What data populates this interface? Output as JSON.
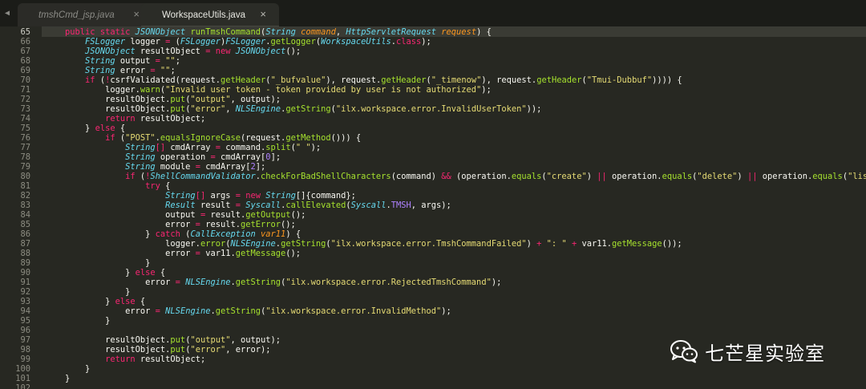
{
  "tabs": [
    {
      "label": "tmshCmd_jsp.java",
      "close": "×",
      "active": false
    },
    {
      "label": "WorkspaceUtils.java",
      "close": "×",
      "active": true
    }
  ],
  "tab_scroll_icon": "◀",
  "watermark": {
    "text": "七芒星实验室",
    "icon": "wechat-icon"
  },
  "colors": {
    "background": "#272822",
    "keyword": "#f92672",
    "type": "#66d9ef",
    "function": "#a6e22e",
    "string": "#e6db74",
    "number": "#ae81ff",
    "param": "#fd971f",
    "plain": "#f8f8f2"
  },
  "editor": {
    "current_line": "65",
    "lines": [
      {
        "n": "65",
        "tokens": [
          [
            "pl",
            "    "
          ],
          [
            "kw",
            "public static "
          ],
          [
            "ty",
            "JSONObject "
          ],
          [
            "fn",
            "runTmshCommand"
          ],
          [
            "pl",
            "("
          ],
          [
            "ty",
            "String "
          ],
          [
            "pa",
            "command"
          ],
          [
            "pl",
            ", "
          ],
          [
            "ty",
            "HttpServletRequest "
          ],
          [
            "pa",
            "request"
          ],
          [
            "pl",
            ") {"
          ]
        ]
      },
      {
        "n": "66",
        "tokens": [
          [
            "pl",
            "        "
          ],
          [
            "ty",
            "FSLogger"
          ],
          [
            "pl",
            " logger "
          ],
          [
            "kw",
            "="
          ],
          [
            "pl",
            " ("
          ],
          [
            "ty",
            "FSLogger"
          ],
          [
            "pl",
            ")"
          ],
          [
            "ty",
            "FSLogger"
          ],
          [
            "pl",
            "."
          ],
          [
            "fn",
            "getLogger"
          ],
          [
            "pl",
            "("
          ],
          [
            "ty",
            "WorkspaceUtils"
          ],
          [
            "pl",
            "."
          ],
          [
            "kw",
            "class"
          ],
          [
            "pl",
            ");"
          ]
        ]
      },
      {
        "n": "67",
        "tokens": [
          [
            "pl",
            "        "
          ],
          [
            "ty",
            "JSONObject"
          ],
          [
            "pl",
            " resultObject "
          ],
          [
            "kw",
            "= new "
          ],
          [
            "ty",
            "JSONObject"
          ],
          [
            "pl",
            "();"
          ]
        ]
      },
      {
        "n": "68",
        "tokens": [
          [
            "pl",
            "        "
          ],
          [
            "ty",
            "String"
          ],
          [
            "pl",
            " output "
          ],
          [
            "kw",
            "="
          ],
          [
            "pl",
            " "
          ],
          [
            "st",
            "\"\""
          ],
          [
            "pl",
            ";"
          ]
        ]
      },
      {
        "n": "69",
        "tokens": [
          [
            "pl",
            "        "
          ],
          [
            "ty",
            "String"
          ],
          [
            "pl",
            " error "
          ],
          [
            "kw",
            "="
          ],
          [
            "pl",
            " "
          ],
          [
            "st",
            "\"\""
          ],
          [
            "pl",
            ";"
          ]
        ]
      },
      {
        "n": "70",
        "tokens": [
          [
            "pl",
            "        "
          ],
          [
            "kw",
            "if"
          ],
          [
            "pl",
            " ("
          ],
          [
            "kw",
            "!"
          ],
          [
            "pl",
            "csrfValidated(request."
          ],
          [
            "fn",
            "getHeader"
          ],
          [
            "pl",
            "("
          ],
          [
            "st",
            "\"_bufvalue\""
          ],
          [
            "pl",
            "), request."
          ],
          [
            "fn",
            "getHeader"
          ],
          [
            "pl",
            "("
          ],
          [
            "st",
            "\"_timenow\""
          ],
          [
            "pl",
            "), request."
          ],
          [
            "fn",
            "getHeader"
          ],
          [
            "pl",
            "("
          ],
          [
            "st",
            "\"Tmui-Dubbuf\""
          ],
          [
            "pl",
            ")))) {"
          ]
        ]
      },
      {
        "n": "71",
        "tokens": [
          [
            "pl",
            "            logger."
          ],
          [
            "fn",
            "warn"
          ],
          [
            "pl",
            "("
          ],
          [
            "st",
            "\"Invalid user token - token provided by user is not authorized\""
          ],
          [
            "pl",
            ");"
          ]
        ]
      },
      {
        "n": "72",
        "tokens": [
          [
            "pl",
            "            resultObject."
          ],
          [
            "fn",
            "put"
          ],
          [
            "pl",
            "("
          ],
          [
            "st",
            "\"output\""
          ],
          [
            "pl",
            ", output);"
          ]
        ]
      },
      {
        "n": "73",
        "tokens": [
          [
            "pl",
            "            resultObject."
          ],
          [
            "fn",
            "put"
          ],
          [
            "pl",
            "("
          ],
          [
            "st",
            "\"error\""
          ],
          [
            "pl",
            ", "
          ],
          [
            "ty",
            "NLSEngine"
          ],
          [
            "pl",
            "."
          ],
          [
            "fn",
            "getString"
          ],
          [
            "pl",
            "("
          ],
          [
            "st",
            "\"ilx.workspace.error.InvalidUserToken\""
          ],
          [
            "pl",
            "));"
          ]
        ]
      },
      {
        "n": "74",
        "tokens": [
          [
            "pl",
            "            "
          ],
          [
            "kw",
            "return"
          ],
          [
            "pl",
            " resultObject;"
          ]
        ]
      },
      {
        "n": "75",
        "tokens": [
          [
            "pl",
            "        } "
          ],
          [
            "kw",
            "else"
          ],
          [
            "pl",
            " {"
          ]
        ]
      },
      {
        "n": "76",
        "tokens": [
          [
            "pl",
            "            "
          ],
          [
            "kw",
            "if"
          ],
          [
            "pl",
            " ("
          ],
          [
            "st",
            "\"POST\""
          ],
          [
            "pl",
            "."
          ],
          [
            "fn",
            "equalsIgnoreCase"
          ],
          [
            "pl",
            "(request."
          ],
          [
            "fn",
            "getMethod"
          ],
          [
            "pl",
            "())) {"
          ]
        ]
      },
      {
        "n": "77",
        "tokens": [
          [
            "pl",
            "                "
          ],
          [
            "ty",
            "String"
          ],
          [
            "kw",
            "[]"
          ],
          [
            "pl",
            " cmdArray "
          ],
          [
            "kw",
            "="
          ],
          [
            "pl",
            " command."
          ],
          [
            "fn",
            "split"
          ],
          [
            "pl",
            "("
          ],
          [
            "st",
            "\" \""
          ],
          [
            "pl",
            ");"
          ]
        ]
      },
      {
        "n": "78",
        "tokens": [
          [
            "pl",
            "                "
          ],
          [
            "ty",
            "String"
          ],
          [
            "pl",
            " operation "
          ],
          [
            "kw",
            "="
          ],
          [
            "pl",
            " cmdArray["
          ],
          [
            "nu",
            "0"
          ],
          [
            "pl",
            "];"
          ]
        ]
      },
      {
        "n": "79",
        "tokens": [
          [
            "pl",
            "                "
          ],
          [
            "ty",
            "String"
          ],
          [
            "pl",
            " module "
          ],
          [
            "kw",
            "="
          ],
          [
            "pl",
            " cmdArray["
          ],
          [
            "nu",
            "2"
          ],
          [
            "pl",
            "];"
          ]
        ]
      },
      {
        "n": "80",
        "tokens": [
          [
            "pl",
            "                "
          ],
          [
            "kw",
            "if"
          ],
          [
            "pl",
            " ("
          ],
          [
            "kw",
            "!"
          ],
          [
            "ty",
            "ShellCommandValidator"
          ],
          [
            "pl",
            "."
          ],
          [
            "fn",
            "checkForBadShellCharacters"
          ],
          [
            "pl",
            "(command) "
          ],
          [
            "kw",
            "&&"
          ],
          [
            "pl",
            " (operation."
          ],
          [
            "fn",
            "equals"
          ],
          [
            "pl",
            "("
          ],
          [
            "st",
            "\"create\""
          ],
          [
            "pl",
            ") "
          ],
          [
            "kw",
            "||"
          ],
          [
            "pl",
            " operation."
          ],
          [
            "fn",
            "equals"
          ],
          [
            "pl",
            "("
          ],
          [
            "st",
            "\"delete\""
          ],
          [
            "pl",
            ") "
          ],
          [
            "kw",
            "||"
          ],
          [
            "pl",
            " operation."
          ],
          [
            "fn",
            "equals"
          ],
          [
            "pl",
            "("
          ],
          [
            "st",
            "\"list\""
          ],
          [
            "pl",
            ") "
          ],
          [
            "kw",
            "||"
          ],
          [
            "pl",
            " operation."
          ],
          [
            "fn",
            "equals"
          ],
          [
            "pl",
            "("
          ]
        ]
      },
      {
        "n": "81",
        "tokens": [
          [
            "pl",
            "                    "
          ],
          [
            "kw",
            "try"
          ],
          [
            "pl",
            " {"
          ]
        ]
      },
      {
        "n": "82",
        "tokens": [
          [
            "pl",
            "                        "
          ],
          [
            "ty",
            "String"
          ],
          [
            "kw",
            "[]"
          ],
          [
            "pl",
            " args "
          ],
          [
            "kw",
            "= new "
          ],
          [
            "ty",
            "String"
          ],
          [
            "pl",
            "[]{command};"
          ]
        ]
      },
      {
        "n": "83",
        "tokens": [
          [
            "pl",
            "                        "
          ],
          [
            "ty",
            "Result"
          ],
          [
            "pl",
            " result "
          ],
          [
            "kw",
            "="
          ],
          [
            "pl",
            " "
          ],
          [
            "ty",
            "Syscall"
          ],
          [
            "pl",
            "."
          ],
          [
            "fn",
            "callElevated"
          ],
          [
            "pl",
            "("
          ],
          [
            "ty",
            "Syscall"
          ],
          [
            "pl",
            "."
          ],
          [
            "nu",
            "TMSH"
          ],
          [
            "pl",
            ", args);"
          ]
        ]
      },
      {
        "n": "84",
        "tokens": [
          [
            "pl",
            "                        output "
          ],
          [
            "kw",
            "="
          ],
          [
            "pl",
            " result."
          ],
          [
            "fn",
            "getOutput"
          ],
          [
            "pl",
            "();"
          ]
        ]
      },
      {
        "n": "85",
        "tokens": [
          [
            "pl",
            "                        error "
          ],
          [
            "kw",
            "="
          ],
          [
            "pl",
            " result."
          ],
          [
            "fn",
            "getError"
          ],
          [
            "pl",
            "();"
          ]
        ]
      },
      {
        "n": "86",
        "tokens": [
          [
            "pl",
            "                    } "
          ],
          [
            "kw",
            "catch"
          ],
          [
            "pl",
            " ("
          ],
          [
            "ty",
            "CallException"
          ],
          [
            "pl",
            " "
          ],
          [
            "pa",
            "var11"
          ],
          [
            "pl",
            ") {"
          ]
        ]
      },
      {
        "n": "87",
        "tokens": [
          [
            "pl",
            "                        logger."
          ],
          [
            "fn",
            "error"
          ],
          [
            "pl",
            "("
          ],
          [
            "ty",
            "NLSEngine"
          ],
          [
            "pl",
            "."
          ],
          [
            "fn",
            "getString"
          ],
          [
            "pl",
            "("
          ],
          [
            "st",
            "\"ilx.workspace.error.TmshCommandFailed\""
          ],
          [
            "pl",
            ") "
          ],
          [
            "kw",
            "+"
          ],
          [
            "pl",
            " "
          ],
          [
            "st",
            "\": \""
          ],
          [
            "pl",
            " "
          ],
          [
            "kw",
            "+"
          ],
          [
            "pl",
            " var11."
          ],
          [
            "fn",
            "getMessage"
          ],
          [
            "pl",
            "());"
          ]
        ]
      },
      {
        "n": "88",
        "tokens": [
          [
            "pl",
            "                        error "
          ],
          [
            "kw",
            "="
          ],
          [
            "pl",
            " var11."
          ],
          [
            "fn",
            "getMessage"
          ],
          [
            "pl",
            "();"
          ]
        ]
      },
      {
        "n": "89",
        "tokens": [
          [
            "pl",
            "                    }"
          ]
        ]
      },
      {
        "n": "90",
        "tokens": [
          [
            "pl",
            "                } "
          ],
          [
            "kw",
            "else"
          ],
          [
            "pl",
            " {"
          ]
        ]
      },
      {
        "n": "91",
        "tokens": [
          [
            "pl",
            "                    error "
          ],
          [
            "kw",
            "="
          ],
          [
            "pl",
            " "
          ],
          [
            "ty",
            "NLSEngine"
          ],
          [
            "pl",
            "."
          ],
          [
            "fn",
            "getString"
          ],
          [
            "pl",
            "("
          ],
          [
            "st",
            "\"ilx.workspace.error.RejectedTmshCommand\""
          ],
          [
            "pl",
            ");"
          ]
        ]
      },
      {
        "n": "92",
        "tokens": [
          [
            "pl",
            "                }"
          ]
        ]
      },
      {
        "n": "93",
        "tokens": [
          [
            "pl",
            "            } "
          ],
          [
            "kw",
            "else"
          ],
          [
            "pl",
            " {"
          ]
        ]
      },
      {
        "n": "94",
        "tokens": [
          [
            "pl",
            "                error "
          ],
          [
            "kw",
            "="
          ],
          [
            "pl",
            " "
          ],
          [
            "ty",
            "NLSEngine"
          ],
          [
            "pl",
            "."
          ],
          [
            "fn",
            "getString"
          ],
          [
            "pl",
            "("
          ],
          [
            "st",
            "\"ilx.workspace.error.InvalidMethod\""
          ],
          [
            "pl",
            ");"
          ]
        ]
      },
      {
        "n": "95",
        "tokens": [
          [
            "pl",
            "            }"
          ]
        ]
      },
      {
        "n": "96",
        "tokens": []
      },
      {
        "n": "97",
        "tokens": [
          [
            "pl",
            "            resultObject."
          ],
          [
            "fn",
            "put"
          ],
          [
            "pl",
            "("
          ],
          [
            "st",
            "\"output\""
          ],
          [
            "pl",
            ", output);"
          ]
        ]
      },
      {
        "n": "98",
        "tokens": [
          [
            "pl",
            "            resultObject."
          ],
          [
            "fn",
            "put"
          ],
          [
            "pl",
            "("
          ],
          [
            "st",
            "\"error\""
          ],
          [
            "pl",
            ", error);"
          ]
        ]
      },
      {
        "n": "99",
        "tokens": [
          [
            "pl",
            "            "
          ],
          [
            "kw",
            "return"
          ],
          [
            "pl",
            " resultObject;"
          ]
        ]
      },
      {
        "n": "100",
        "tokens": [
          [
            "pl",
            "        }"
          ]
        ]
      },
      {
        "n": "101",
        "tokens": [
          [
            "pl",
            "    }"
          ]
        ]
      },
      {
        "n": "102",
        "tokens": []
      }
    ]
  }
}
